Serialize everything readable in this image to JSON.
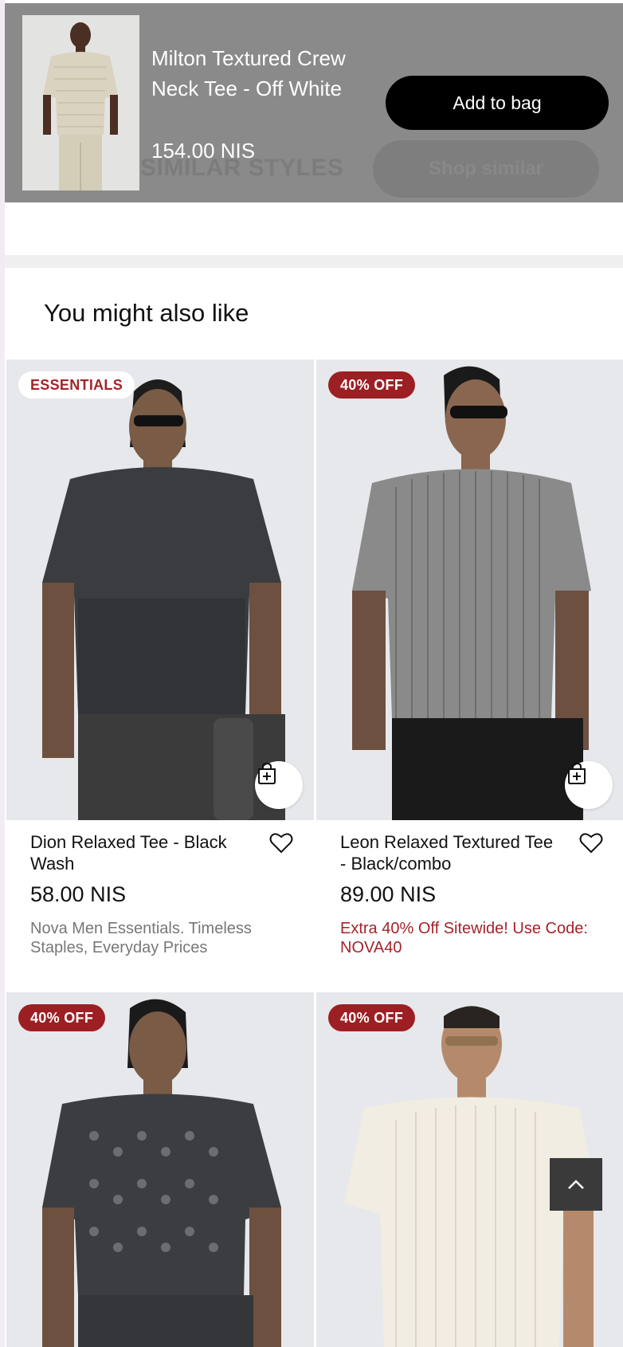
{
  "sticky": {
    "ghost_heading": "SIMILAR STYLES",
    "ghost_button": "Shop similar",
    "product_title": "Milton Textured Crew Neck Tee - Off White",
    "price": "154.00 NIS",
    "add_to_bag_label": "Add to bag"
  },
  "section": {
    "heading": "You might also like"
  },
  "products": [
    {
      "badge": "ESSENTIALS",
      "name": "Dion Relaxed Tee - Black Wash",
      "price": "58.00 NIS",
      "promo": "Nova Men Essentials. Timeless Staples, Everyday Prices"
    },
    {
      "badge": "40% OFF",
      "name": "Leon Relaxed Textured Tee - Black/combo",
      "price": "89.00 NIS",
      "promo": "Extra 40% Off Sitewide! Use Code: NOVA40"
    },
    {
      "badge": "40% OFF"
    },
    {
      "badge": "40% OFF"
    }
  ],
  "icons": {
    "quick_add": "bag-plus-icon",
    "wishlist": "heart-icon",
    "scroll_top": "chevron-up-icon"
  },
  "colors": {
    "accent_red": "#9c1f24",
    "promo_red": "#a3242a",
    "button_black": "#000000"
  }
}
